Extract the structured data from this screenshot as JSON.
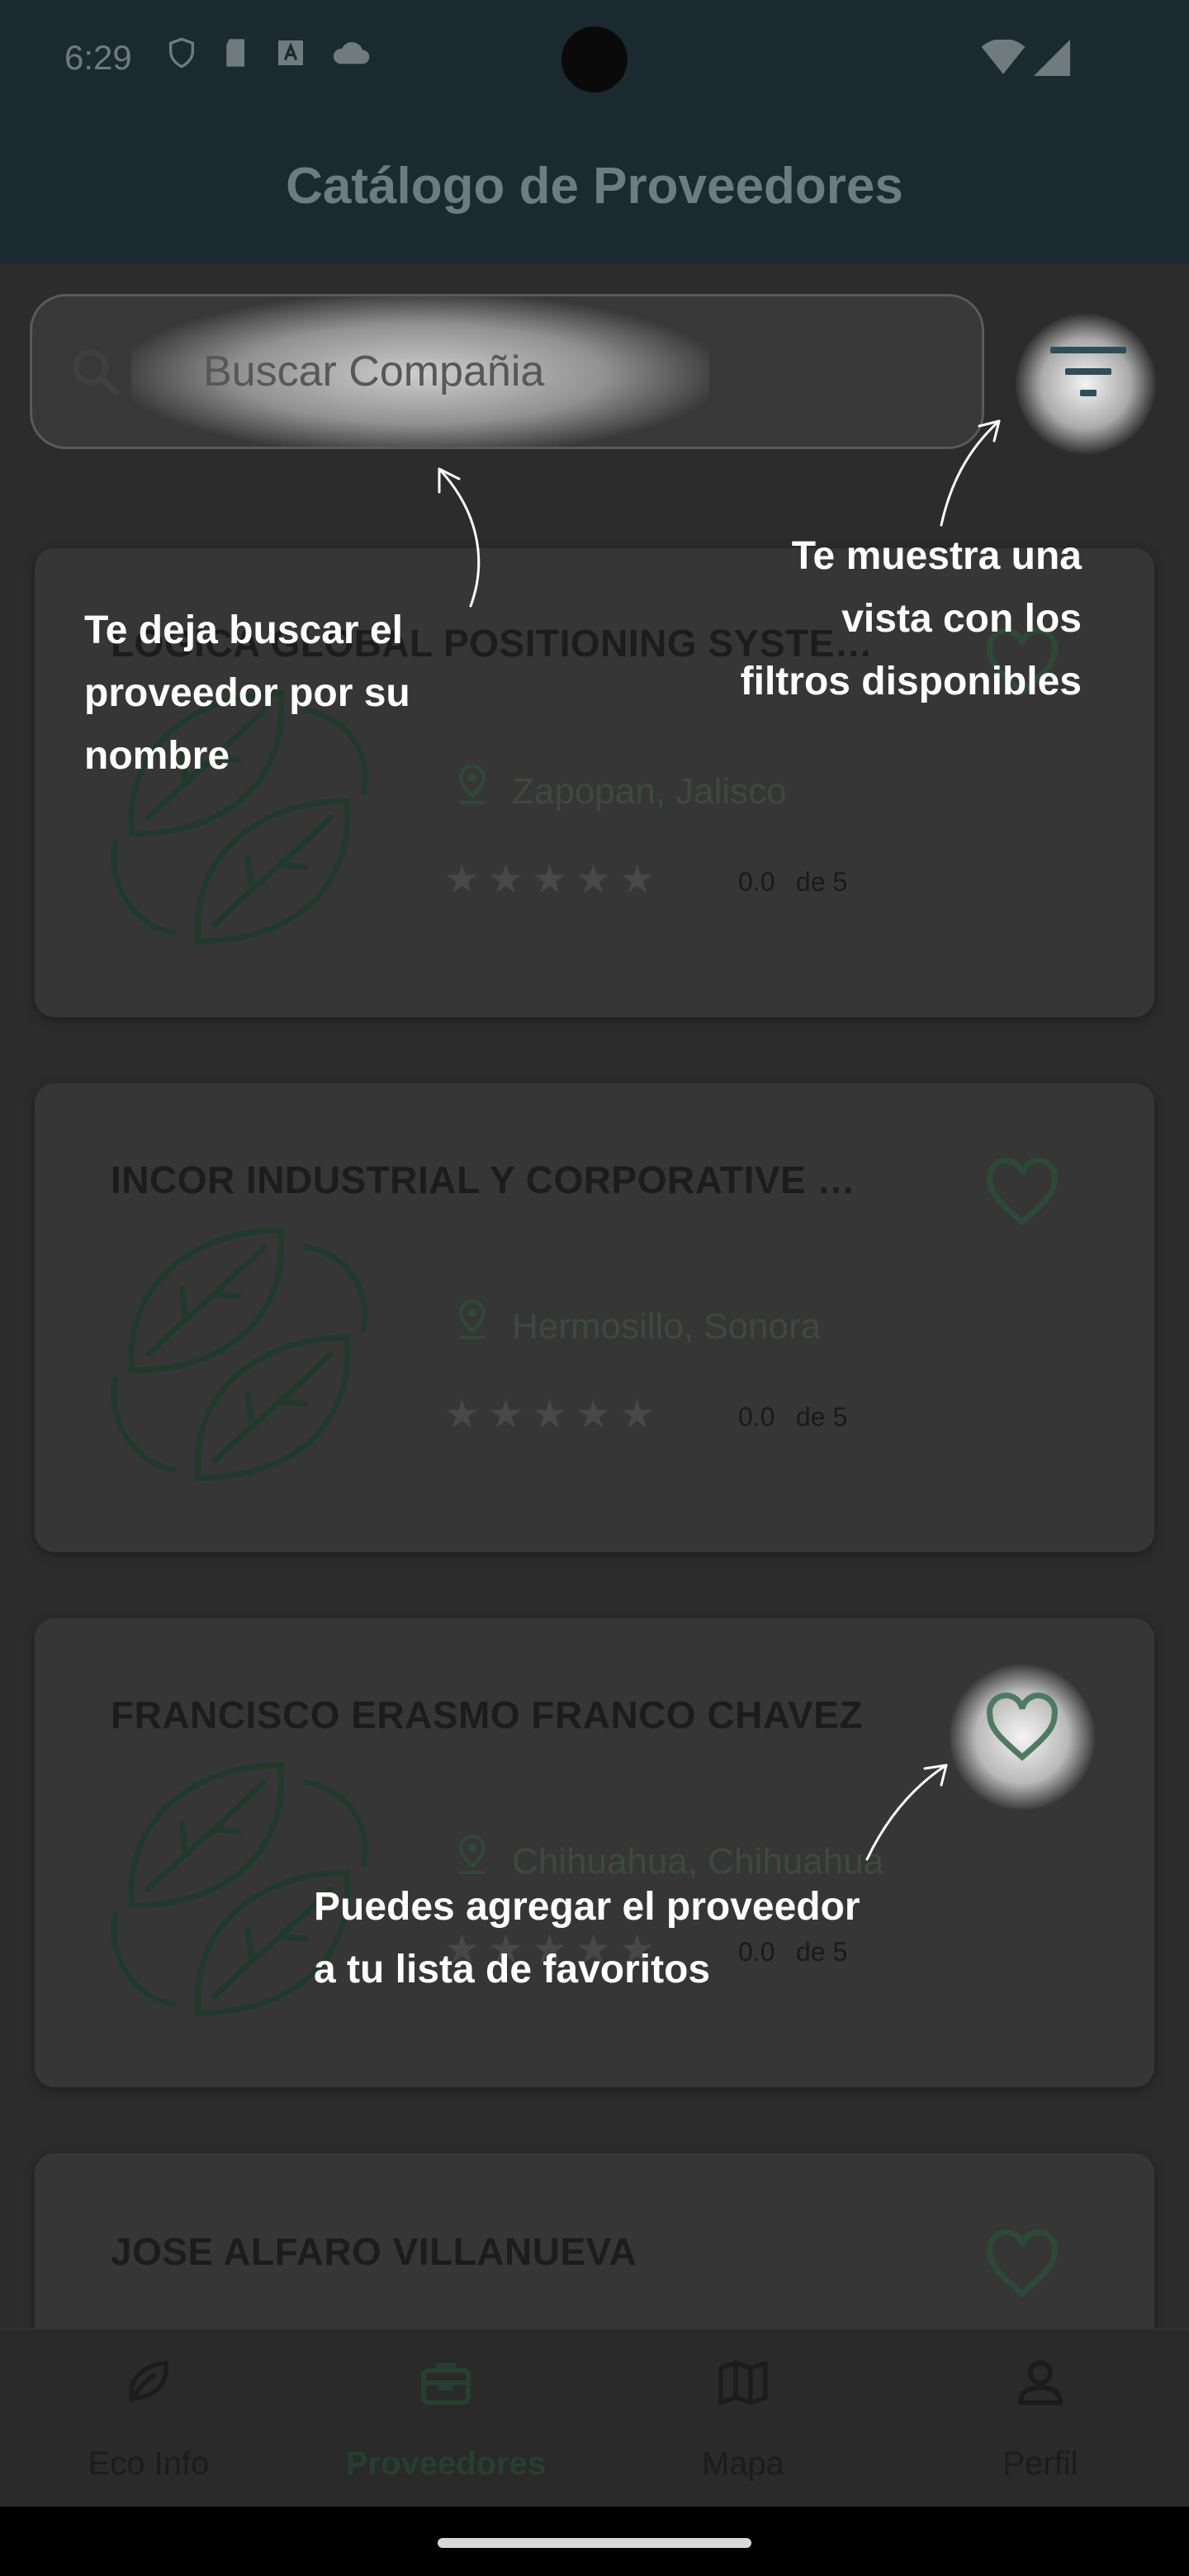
{
  "status_bar": {
    "time": "6:29"
  },
  "app_bar": {
    "title": "Catálogo de Proveedores"
  },
  "search": {
    "placeholder": "Buscar Compañia"
  },
  "providers": [
    {
      "name": "LOGICA GLOBAL POSITIONING SYSTE…",
      "location": "Zapopan, Jalisco",
      "rating": "0.0",
      "rating_suffix": "de 5"
    },
    {
      "name": "INCOR INDUSTRIAL Y CORPORATIVE …",
      "location": "Hermosillo, Sonora",
      "rating": "0.0",
      "rating_suffix": "de 5"
    },
    {
      "name": "FRANCISCO ERASMO FRANCO CHAVEZ",
      "location": "Chihuahua, Chihuahua",
      "rating": "0.0",
      "rating_suffix": "de 5"
    },
    {
      "name": "JOSE ALFARO VILLANUEVA"
    }
  ],
  "tips": {
    "search": [
      "Te deja buscar el",
      "proveedor por su",
      "nombre"
    ],
    "filters": [
      "Te muestra una",
      "vista con los",
      "filtros disponibles"
    ],
    "favorite": [
      "Puedes agregar el proveedor",
      "a tu lista de favoritos"
    ]
  },
  "nav": [
    {
      "label": "Eco Info",
      "icon": "leaf-icon",
      "active": false
    },
    {
      "label": "Proveedores",
      "icon": "briefcase-icon",
      "active": true
    },
    {
      "label": "Mapa",
      "icon": "map-icon",
      "active": false
    },
    {
      "label": "Perfil",
      "icon": "person-icon",
      "active": false
    }
  ],
  "colors": {
    "accent": "#25402e",
    "overlay": "#2c2c2c",
    "app_bar": "#1b2a30"
  }
}
